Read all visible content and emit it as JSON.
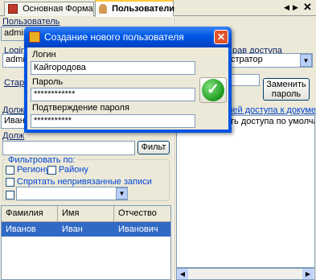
{
  "tabs": {
    "main_form": "Основная Форма",
    "users": "Пользователи"
  },
  "left": {
    "user_label": "Пользователь",
    "user_value": "admin:",
    "login_label": "Login",
    "login_value": "admin",
    "old_label": "Старь",
    "position_label": "Долж",
    "position_value": "Ивано",
    "position2_label": "Долж",
    "filter_button": "Фильт",
    "filter_by_label": "Фильтровать по:",
    "region_label": "Региону",
    "district_label": "Району",
    "hide_unlinked_label": "Спрятать непривязанные записи"
  },
  "table": {
    "headers": [
      "Фамилия",
      "Имя",
      "Отчество"
    ],
    "rows": [
      [
        "Иванов",
        "Иван",
        "Иванович"
      ]
    ]
  },
  "right": {
    "access_rights_label": "рав доступа",
    "role_value": "стратор",
    "change_password_button": "Заменить пароль",
    "doc_access_header": "лей доступа к документа",
    "doc_access_item": "ть доступа по умолчание"
  },
  "dialog": {
    "title": "Создание нового пользователя",
    "login_label": "Логин",
    "login_value": "Кайгородова",
    "password_label": "Пароль",
    "password_value": "************",
    "confirm_label": "Подтверждение пароля",
    "confirm_value": "***********"
  }
}
